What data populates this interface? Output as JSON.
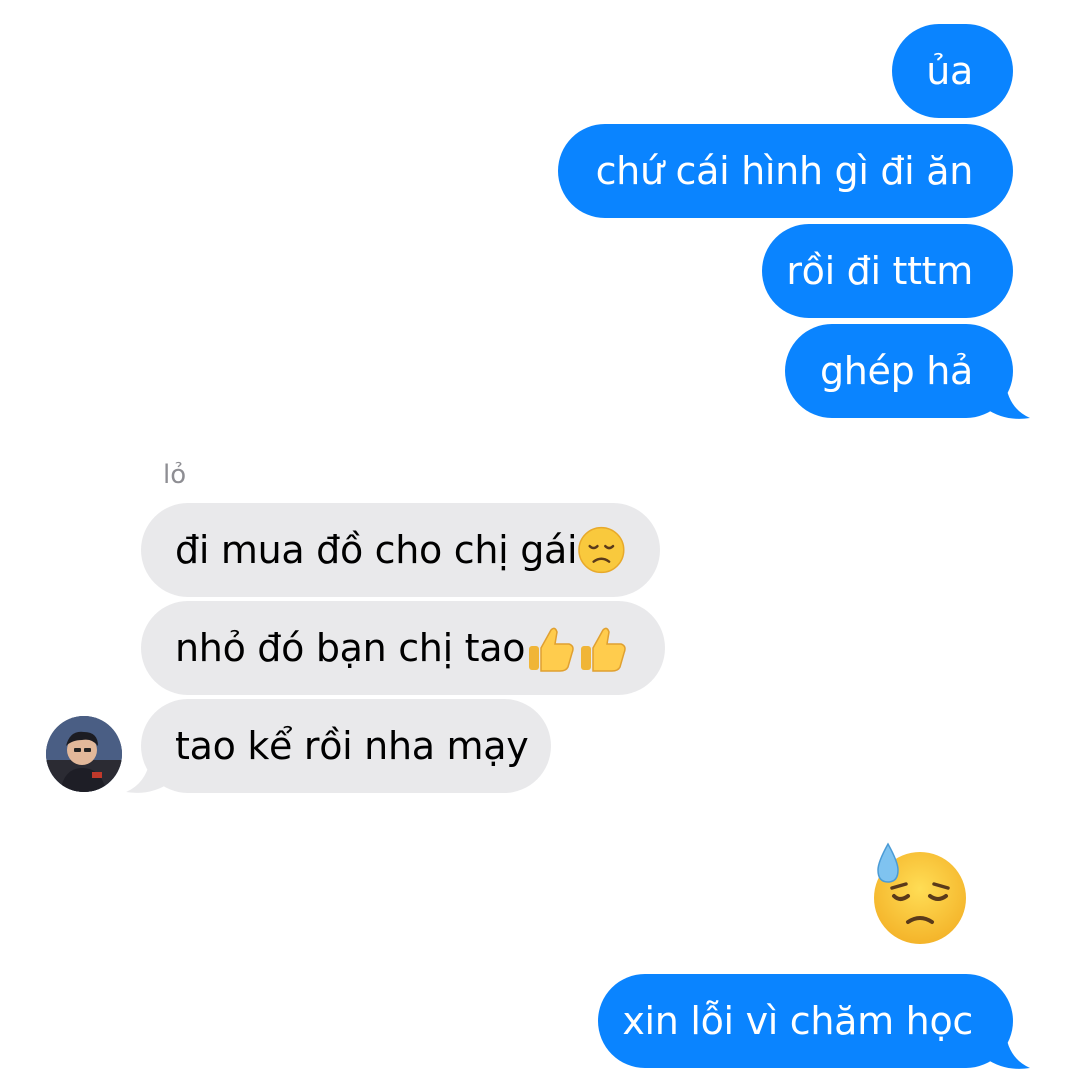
{
  "conversation": {
    "sent_group_1": [
      {
        "text": "ủa"
      },
      {
        "text": "chứ cái hình gì đi ăn"
      },
      {
        "text": "rồi đi tttm"
      },
      {
        "text": "ghép hả"
      }
    ],
    "received_group": {
      "sender_name": "lỏ",
      "messages": [
        {
          "text": "đi mua đồ cho chị gái",
          "emoji": "disappointed-face"
        },
        {
          "text": "nhỏ đó bạn chị tao",
          "emoji": "thumbs-up x2"
        },
        {
          "text": "tao kể rồi nha mạy"
        }
      ],
      "avatar": "profile-photo"
    },
    "sent_group_2": [
      {
        "emoji": "downcast-face-with-sweat"
      },
      {
        "text": "xin lỗi vì chăm học"
      }
    ]
  },
  "colors": {
    "sent_bubble": "#0a84ff",
    "received_bubble": "#e9e9eb",
    "sender_label": "#8e8e93"
  }
}
